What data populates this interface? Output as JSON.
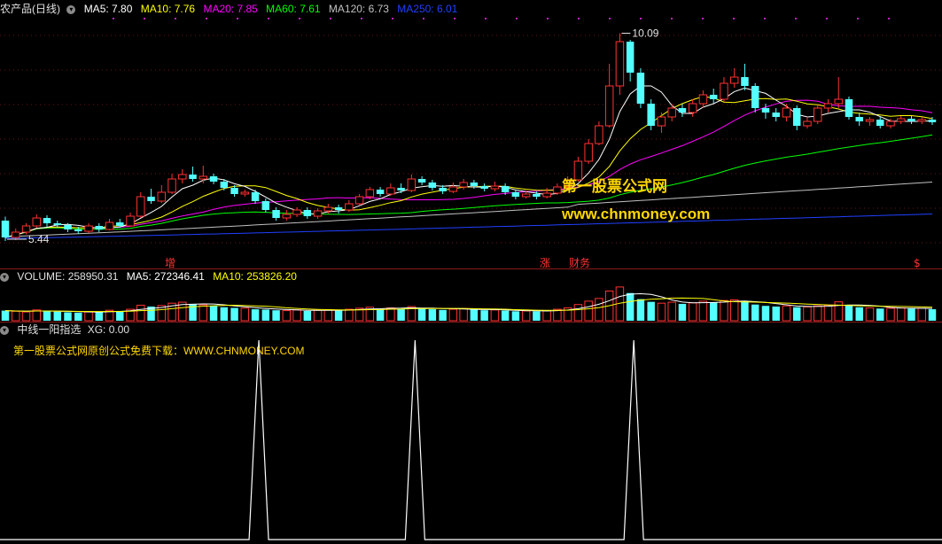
{
  "main_header": {
    "title": "农产品(日线)",
    "ma5": "MA5: 7.80",
    "ma10": "MA10: 7.76",
    "ma20": "MA20: 7.85",
    "ma60": "MA60: 7.61",
    "ma120": "MA120: 6.73",
    "ma250": "MA250: 6.01"
  },
  "volume_header": {
    "volume": "VOLUME: 258950.31",
    "ma5": "MA5: 272346.41",
    "ma10": "MA10: 253826.20"
  },
  "indicator_header": {
    "name": "中线一阳指选",
    "xg": "XG: 0.00"
  },
  "annotations": {
    "high_label": "10.09",
    "low_label": "5.44",
    "tag_zeng": "增",
    "tag_zhang": "涨",
    "tag_caiwu": "财务",
    "tag_dollar": "$"
  },
  "watermark": {
    "line1": "第一股票公式网",
    "line2": "www.chnmoney.com",
    "sub": "第一股票公式网原创公式免费下载：WWW.CHNMONEY.COM"
  },
  "colors": {
    "up": "#ff3232",
    "down": "#54ffff",
    "ma5": "#ffffff",
    "ma10": "#ffff00",
    "ma20": "#ff00ff",
    "ma60": "#00ff00",
    "ma120": "#c0c0c0",
    "ma250": "#2040ff",
    "xg": "#ffffff"
  },
  "chart_data": [
    {
      "type": "candlestick",
      "title": "农产品(日线)",
      "ylim": [
        5.2,
        10.4
      ],
      "high_marker": 10.09,
      "low_marker": 5.44,
      "ma_values": {
        "MA5": 7.8,
        "MA10": 7.76,
        "MA20": 7.85,
        "MA60": 7.61,
        "MA120": 6.73,
        "MA250": 6.01
      },
      "candles": [
        [
          5.86,
          5.48,
          5.95,
          5.4
        ],
        [
          5.48,
          5.6,
          5.68,
          5.42
        ],
        [
          5.6,
          5.74,
          5.8,
          5.55
        ],
        [
          5.74,
          5.92,
          6.0,
          5.7
        ],
        [
          5.92,
          5.8,
          5.98,
          5.72
        ],
        [
          5.8,
          5.76,
          5.86,
          5.7
        ],
        [
          5.76,
          5.66,
          5.8,
          5.6
        ],
        [
          5.66,
          5.62,
          5.72,
          5.56
        ],
        [
          5.62,
          5.74,
          5.8,
          5.58
        ],
        [
          5.74,
          5.66,
          5.8,
          5.6
        ],
        [
          5.66,
          5.82,
          5.9,
          5.64
        ],
        [
          5.82,
          5.74,
          5.9,
          5.7
        ],
        [
          5.74,
          5.96,
          6.04,
          5.72
        ],
        [
          5.96,
          6.4,
          6.5,
          5.92
        ],
        [
          6.4,
          6.3,
          6.58,
          6.24
        ],
        [
          6.3,
          6.5,
          6.66,
          6.26
        ],
        [
          6.5,
          6.8,
          6.92,
          6.46
        ],
        [
          6.8,
          6.9,
          7.02,
          6.7
        ],
        [
          6.9,
          6.8,
          7.08,
          6.74
        ],
        [
          6.8,
          6.86,
          7.1,
          6.7
        ],
        [
          6.86,
          6.74,
          6.92,
          6.68
        ],
        [
          6.74,
          6.6,
          6.8,
          6.54
        ],
        [
          6.6,
          6.46,
          6.66,
          6.4
        ],
        [
          6.46,
          6.5,
          6.56,
          6.4
        ],
        [
          6.5,
          6.3,
          6.56,
          6.24
        ],
        [
          6.3,
          6.1,
          6.36,
          6.04
        ],
        [
          6.1,
          5.92,
          6.16,
          5.86
        ],
        [
          5.92,
          6.0,
          6.1,
          5.86
        ],
        [
          6.0,
          6.1,
          6.16,
          5.94
        ],
        [
          6.1,
          5.96,
          6.16,
          5.9
        ],
        [
          5.96,
          6.08,
          6.14,
          5.9
        ],
        [
          6.08,
          6.16,
          6.24,
          6.02
        ],
        [
          6.16,
          6.1,
          6.22,
          6.02
        ],
        [
          6.1,
          6.24,
          6.32,
          6.06
        ],
        [
          6.24,
          6.4,
          6.46,
          6.2
        ],
        [
          6.4,
          6.56,
          6.62,
          6.34
        ],
        [
          6.56,
          6.46,
          6.62,
          6.4
        ],
        [
          6.46,
          6.6,
          6.7,
          6.42
        ],
        [
          6.6,
          6.54,
          6.7,
          6.48
        ],
        [
          6.54,
          6.8,
          6.9,
          6.5
        ],
        [
          6.8,
          6.72,
          6.86,
          6.66
        ],
        [
          6.72,
          6.6,
          6.78,
          6.54
        ],
        [
          6.6,
          6.52,
          6.66,
          6.46
        ],
        [
          6.52,
          6.62,
          6.72,
          6.48
        ],
        [
          6.62,
          6.72,
          6.8,
          6.56
        ],
        [
          6.72,
          6.64,
          6.78,
          6.58
        ],
        [
          6.64,
          6.58,
          6.7,
          6.52
        ],
        [
          6.58,
          6.64,
          6.74,
          6.52
        ],
        [
          6.64,
          6.5,
          6.7,
          6.44
        ],
        [
          6.5,
          6.4,
          6.56,
          6.34
        ],
        [
          6.4,
          6.46,
          6.54,
          6.36
        ],
        [
          6.46,
          6.4,
          6.52,
          6.34
        ],
        [
          6.4,
          6.48,
          6.6,
          6.36
        ],
        [
          6.48,
          6.62,
          6.7,
          6.44
        ],
        [
          6.62,
          6.78,
          6.86,
          6.56
        ],
        [
          6.78,
          7.2,
          7.3,
          6.74
        ],
        [
          7.2,
          7.6,
          7.7,
          7.14
        ],
        [
          7.6,
          8.0,
          8.1,
          7.56
        ],
        [
          8.0,
          8.9,
          9.4,
          7.96
        ],
        [
          8.9,
          9.9,
          10.09,
          8.7
        ],
        [
          9.9,
          9.2,
          9.94,
          9.0
        ],
        [
          9.2,
          8.5,
          9.3,
          8.4
        ],
        [
          8.5,
          8.0,
          8.6,
          7.9
        ],
        [
          8.0,
          8.2,
          8.3,
          7.84
        ],
        [
          8.2,
          8.4,
          8.5,
          8.1
        ],
        [
          8.4,
          8.3,
          8.5,
          8.2
        ],
        [
          8.3,
          8.5,
          8.6,
          8.2
        ],
        [
          8.5,
          8.7,
          8.8,
          8.4
        ],
        [
          8.7,
          8.6,
          8.84,
          8.5
        ],
        [
          8.6,
          8.96,
          9.1,
          8.54
        ],
        [
          8.96,
          9.1,
          9.3,
          8.86
        ],
        [
          9.1,
          8.9,
          9.4,
          8.8
        ],
        [
          8.9,
          8.4,
          8.96,
          8.3
        ],
        [
          8.4,
          8.3,
          8.5,
          8.16
        ],
        [
          8.3,
          8.2,
          8.4,
          8.1
        ],
        [
          8.2,
          8.4,
          8.5,
          8.1
        ],
        [
          8.4,
          8.0,
          8.46,
          7.9
        ],
        [
          8.0,
          8.1,
          8.2,
          7.94
        ],
        [
          8.1,
          8.4,
          8.5,
          8.04
        ],
        [
          8.4,
          8.5,
          8.6,
          8.3
        ],
        [
          8.5,
          8.6,
          9.1,
          8.4
        ],
        [
          8.6,
          8.2,
          8.66,
          8.14
        ],
        [
          8.2,
          8.1,
          8.3,
          8.0
        ],
        [
          8.1,
          8.14,
          8.2,
          8.0
        ],
        [
          8.14,
          8.0,
          8.2,
          7.94
        ],
        [
          8.0,
          8.1,
          8.16,
          7.94
        ],
        [
          8.1,
          8.16,
          8.22,
          8.04
        ],
        [
          8.16,
          8.1,
          8.22,
          8.04
        ],
        [
          8.1,
          8.14,
          8.2,
          8.04
        ],
        [
          8.14,
          8.08,
          8.2,
          8.02
        ]
      ]
    },
    {
      "type": "bar",
      "title": "VOLUME",
      "values": [
        0.3,
        0.28,
        0.26,
        0.32,
        0.29,
        0.27,
        0.25,
        0.24,
        0.26,
        0.27,
        0.31,
        0.29,
        0.34,
        0.46,
        0.42,
        0.45,
        0.52,
        0.55,
        0.5,
        0.47,
        0.44,
        0.4,
        0.38,
        0.37,
        0.34,
        0.33,
        0.31,
        0.3,
        0.32,
        0.29,
        0.31,
        0.33,
        0.3,
        0.34,
        0.37,
        0.4,
        0.36,
        0.38,
        0.35,
        0.42,
        0.37,
        0.34,
        0.32,
        0.34,
        0.36,
        0.33,
        0.31,
        0.32,
        0.3,
        0.28,
        0.29,
        0.28,
        0.3,
        0.34,
        0.38,
        0.48,
        0.58,
        0.66,
        0.88,
        1.0,
        0.82,
        0.64,
        0.56,
        0.52,
        0.55,
        0.5,
        0.53,
        0.58,
        0.54,
        0.6,
        0.62,
        0.58,
        0.48,
        0.44,
        0.42,
        0.44,
        0.4,
        0.41,
        0.44,
        0.46,
        0.56,
        0.46,
        0.4,
        0.38,
        0.36,
        0.37,
        0.38,
        0.36,
        0.37,
        0.34
      ],
      "ylim": [
        0,
        1.05
      ]
    },
    {
      "type": "line",
      "title": "中线一阳指选",
      "series": [
        {
          "name": "XG",
          "values": [
            0.0
          ]
        }
      ],
      "spike_bar_index": [
        24,
        39,
        60
      ],
      "ylim": [
        0,
        1
      ]
    }
  ]
}
